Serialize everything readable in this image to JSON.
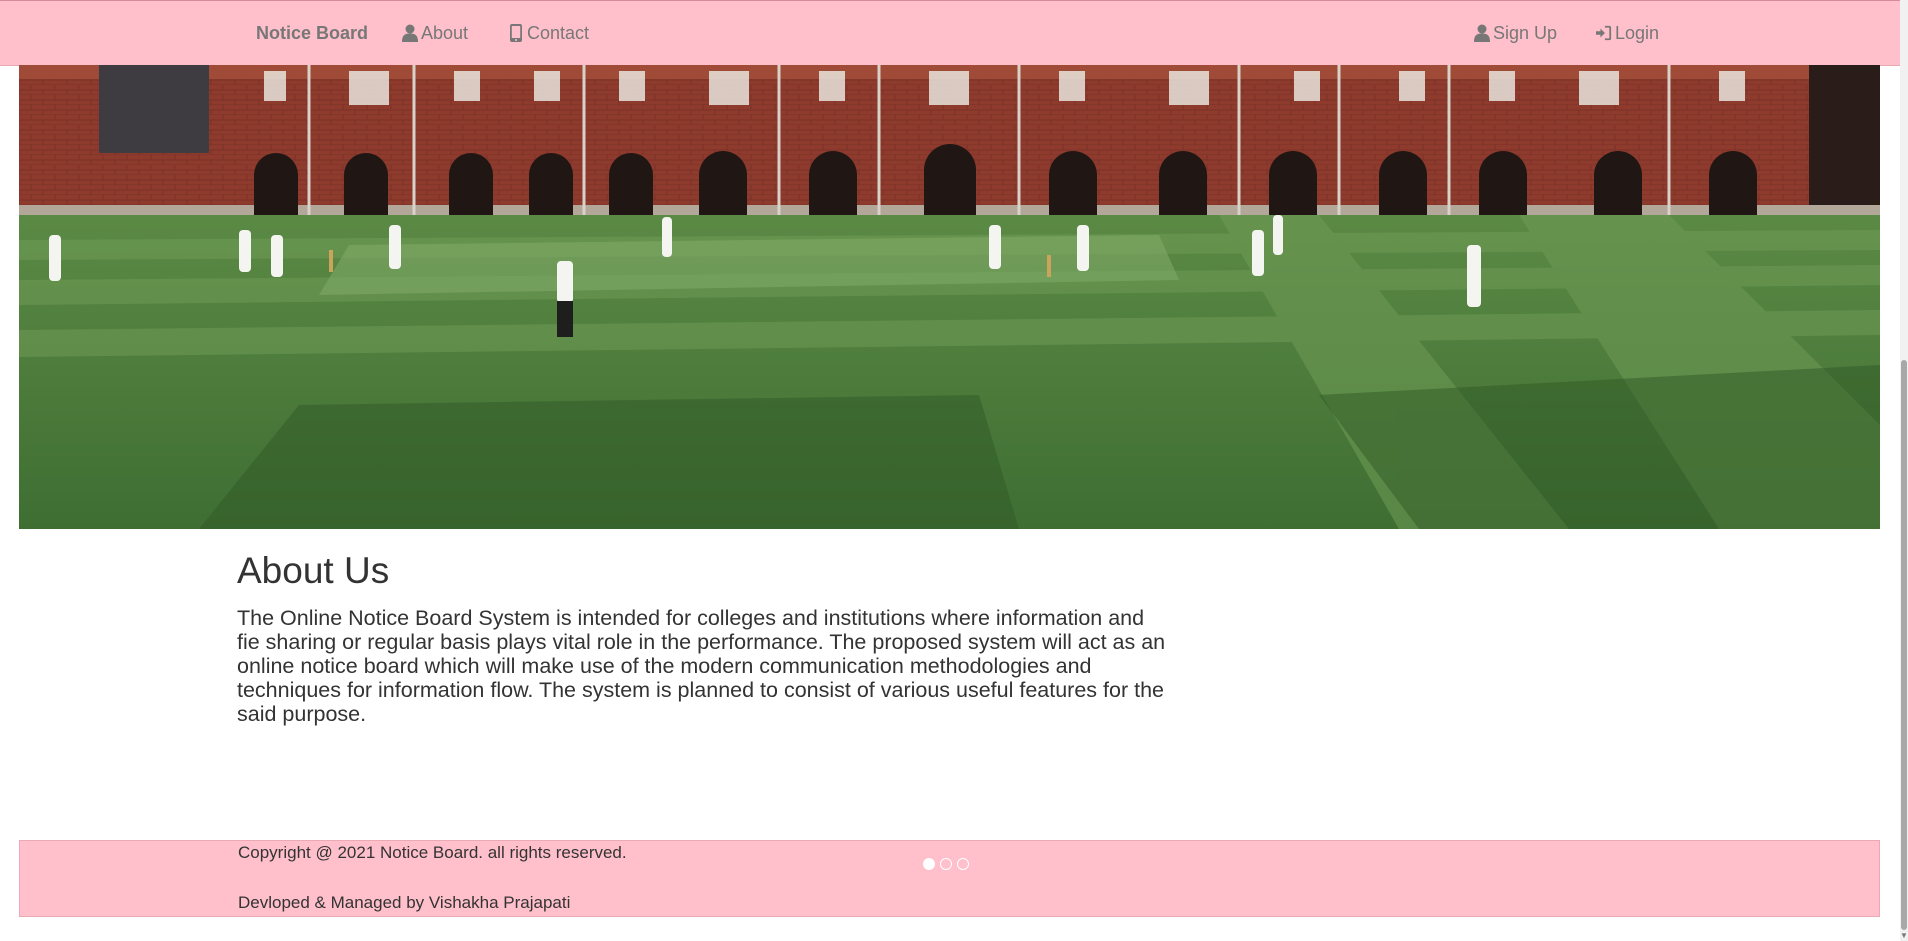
{
  "nav": {
    "brand": "Notice Board",
    "about": "About",
    "contact": "Contact",
    "signup": "Sign Up",
    "login": "Login"
  },
  "about": {
    "title": "About Us",
    "body": "The Online Notice Board System is intended for colleges and institutions where information and fie sharing or regular basis plays vital role in the performance. The proposed system will act as an online notice board which will make use of the modern communication methodologies and techniques for information flow. The system is planned to consist of various useful features for the said purpose."
  },
  "footer": {
    "copyright": "Copyright @ 2021 Notice Board. all rights reserved.",
    "developer": "Devloped & Managed by Vishakha Prajapati"
  },
  "carousel": {
    "slide_count": 3,
    "active_index": 0
  },
  "colors": {
    "nav_bg": "#ffc0cb",
    "nav_text": "#777777",
    "body_text": "#333333"
  }
}
